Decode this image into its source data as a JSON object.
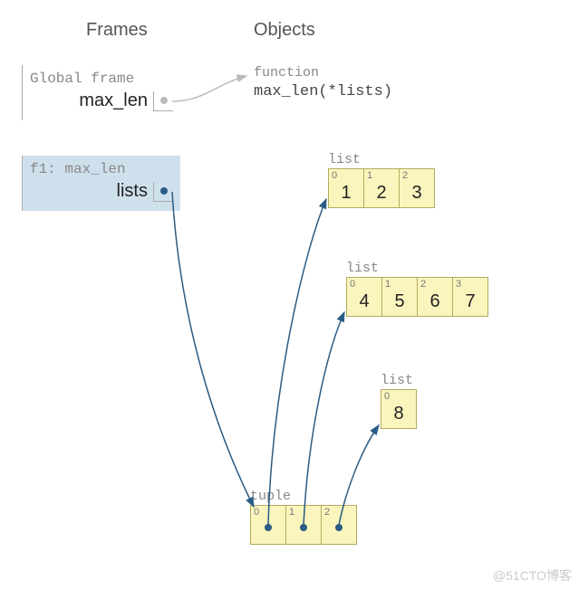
{
  "headings": {
    "frames": "Frames",
    "objects": "Objects"
  },
  "global_frame": {
    "title": "Global frame",
    "var_name": "max_len"
  },
  "f1_frame": {
    "title": "f1: max_len",
    "var_name": "lists"
  },
  "function_obj": {
    "label": "function",
    "signature": "max_len(*lists)"
  },
  "list1": {
    "label": "list",
    "indices": [
      "0",
      "1",
      "2"
    ],
    "values": [
      "1",
      "2",
      "3"
    ]
  },
  "list2": {
    "label": "list",
    "indices": [
      "0",
      "1",
      "2",
      "3"
    ],
    "values": [
      "4",
      "5",
      "6",
      "7"
    ]
  },
  "list3": {
    "label": "list",
    "indices": [
      "0"
    ],
    "values": [
      "8"
    ]
  },
  "tuple_obj": {
    "label": "tuple",
    "indices": [
      "0",
      "1",
      "2"
    ]
  },
  "watermark": "@51CTO博客",
  "chart_data": {
    "type": "table",
    "title": "Python frame/object diagram for max_len(*lists)",
    "frames": [
      {
        "name": "Global frame",
        "vars": [
          {
            "name": "max_len",
            "points_to": "function max_len(*lists)"
          }
        ]
      },
      {
        "name": "f1: max_len",
        "vars": [
          {
            "name": "lists",
            "points_to": "tuple"
          }
        ]
      }
    ],
    "objects": [
      {
        "kind": "function",
        "repr": "max_len(*lists)"
      },
      {
        "kind": "list",
        "id": "list1",
        "items": [
          1,
          2,
          3
        ]
      },
      {
        "kind": "list",
        "id": "list2",
        "items": [
          4,
          5,
          6,
          7
        ]
      },
      {
        "kind": "list",
        "id": "list3",
        "items": [
          8
        ]
      },
      {
        "kind": "tuple",
        "id": "tuple",
        "items_ref": [
          "list1",
          "list2",
          "list3"
        ]
      }
    ]
  }
}
